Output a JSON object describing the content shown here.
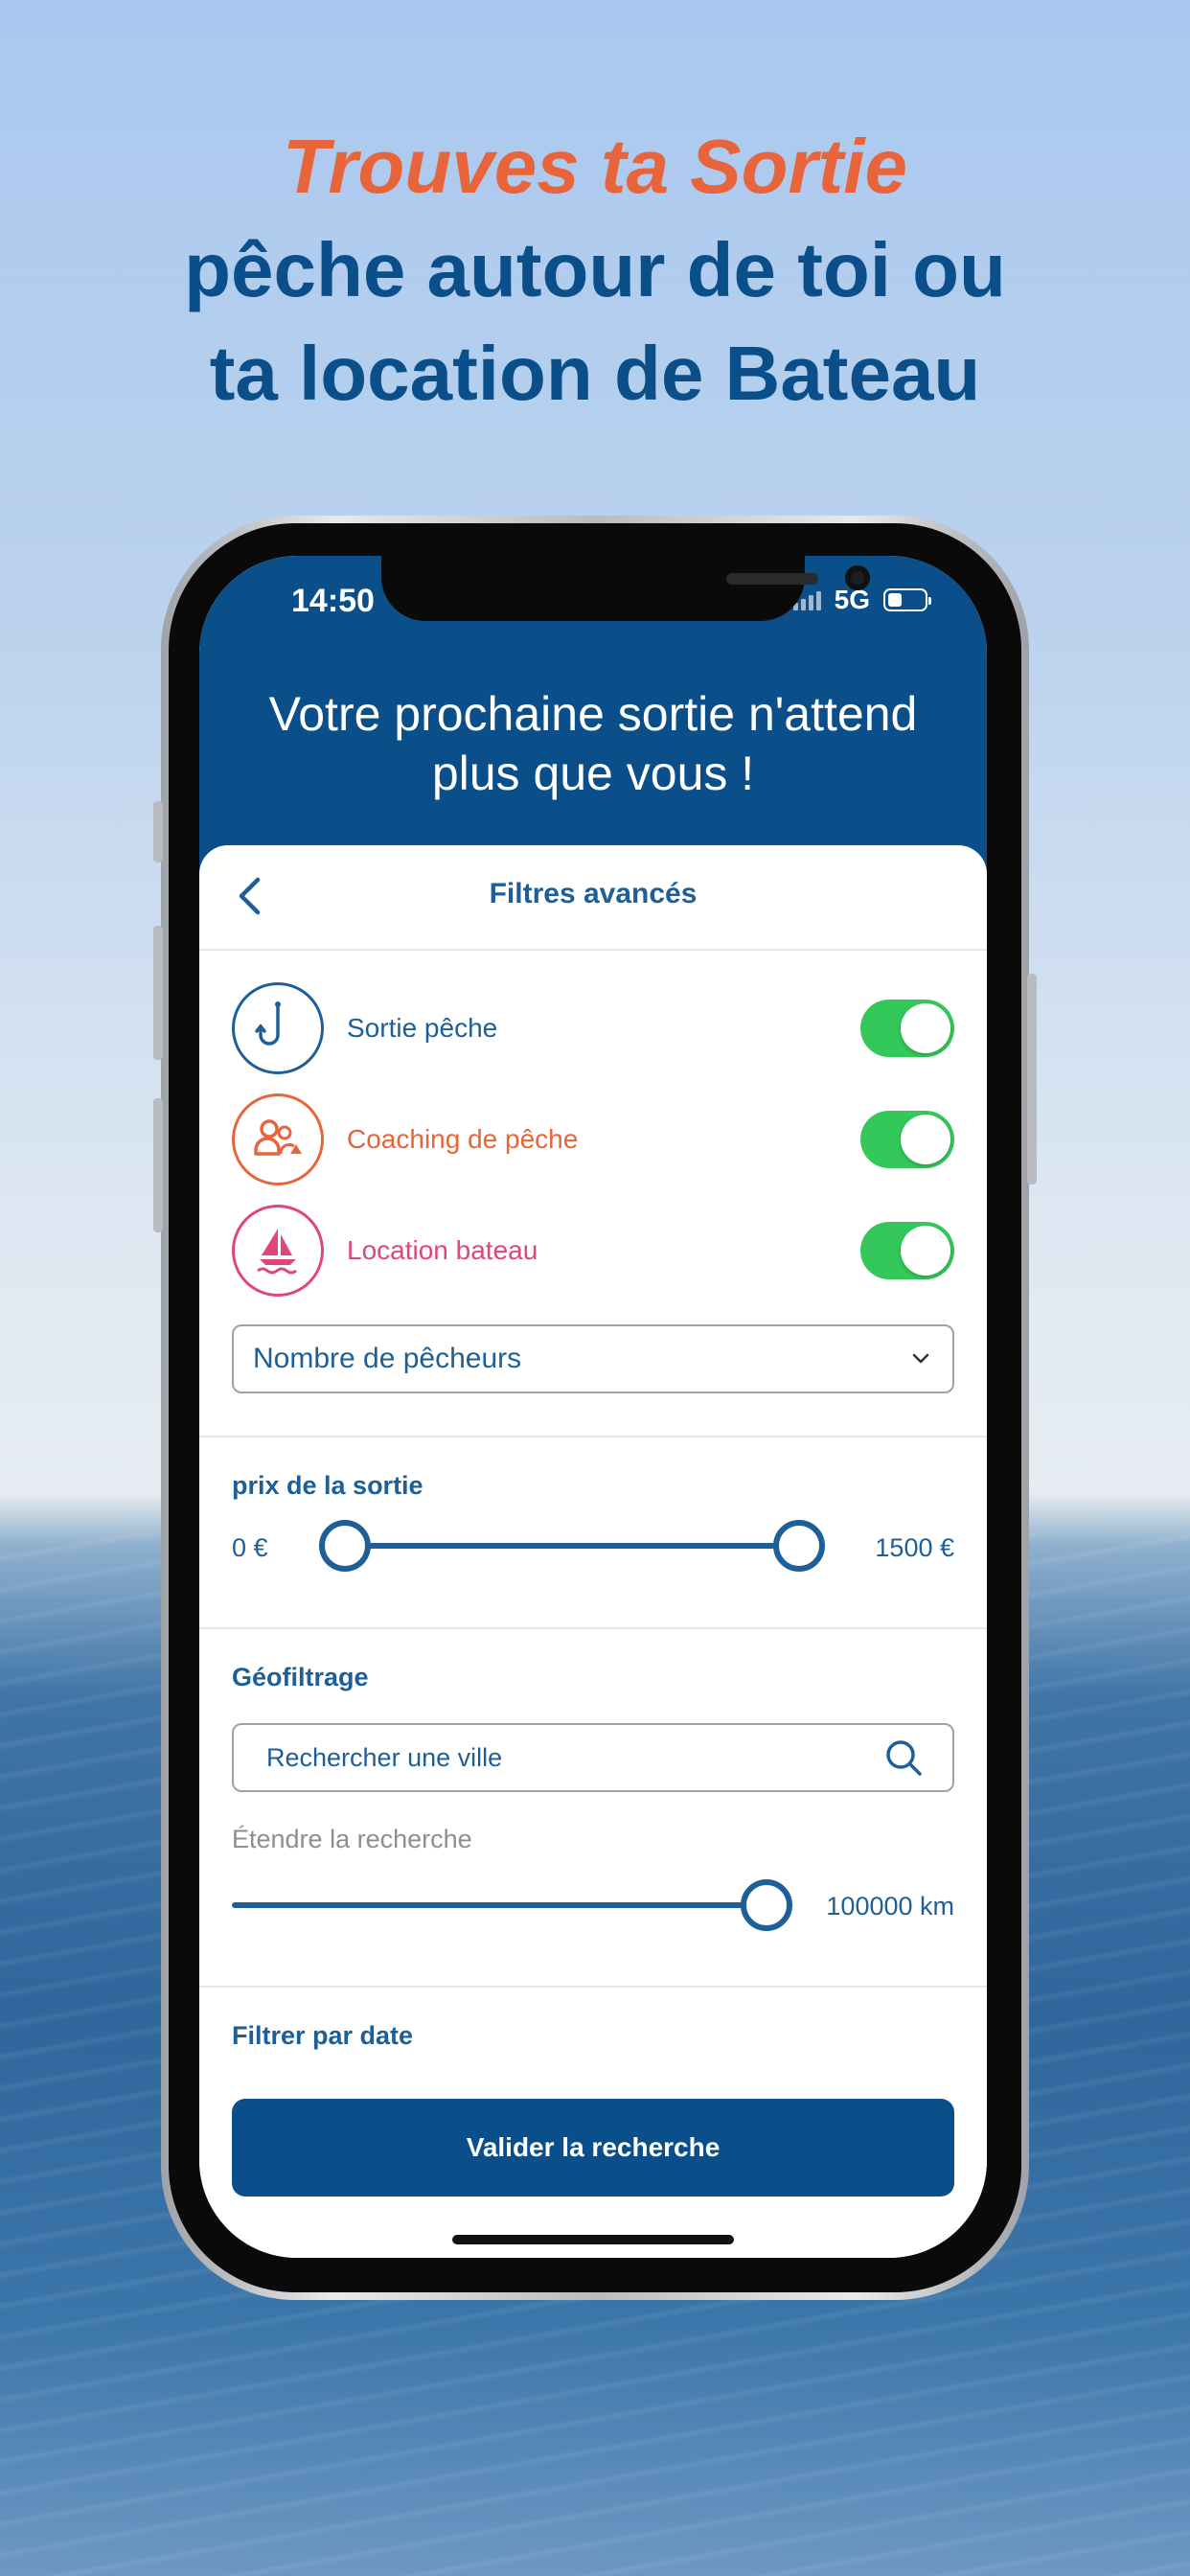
{
  "headline": {
    "accent": "Trouves ta Sortie",
    "line2": "pêche autour de toi ou",
    "line3": "ta location de Bateau"
  },
  "status_bar": {
    "time": "14:50",
    "network": "5G",
    "battery_level": 0.4
  },
  "hero": {
    "line1": "Votre prochaine sortie n'attend",
    "line2": "plus que vous !"
  },
  "nav": {
    "title": "Filtres avancés"
  },
  "filters": [
    {
      "label": "Sortie pêche",
      "icon": "fishing-hook-icon",
      "color": "#1e5f97",
      "enabled": true
    },
    {
      "label": "Coaching de pêche",
      "icon": "coaching-group-icon",
      "color": "#e8643a",
      "enabled": true
    },
    {
      "label": "Location bateau",
      "icon": "sailboat-icon",
      "color": "#e0457b",
      "enabled": true
    }
  ],
  "fishers_select": {
    "value": "Nombre de pêcheurs"
  },
  "price": {
    "label": "prix de la sortie",
    "min_label": "0 €",
    "max_label": "1500 €",
    "min_value": 0,
    "max_value": 1500
  },
  "geo": {
    "label": "Géofiltrage",
    "search_placeholder": "Rechercher une ville",
    "extend_label": "Étendre la recherche",
    "distance_label": "100000 km",
    "distance_fraction": 1.0
  },
  "date": {
    "label": "Filtrer par date"
  },
  "submit": {
    "label": "Valider la recherche"
  },
  "colors": {
    "primary": "#0b4f8a",
    "accent_orange": "#e8643a",
    "accent_pink": "#e0457b",
    "toggle_on": "#34c759"
  }
}
